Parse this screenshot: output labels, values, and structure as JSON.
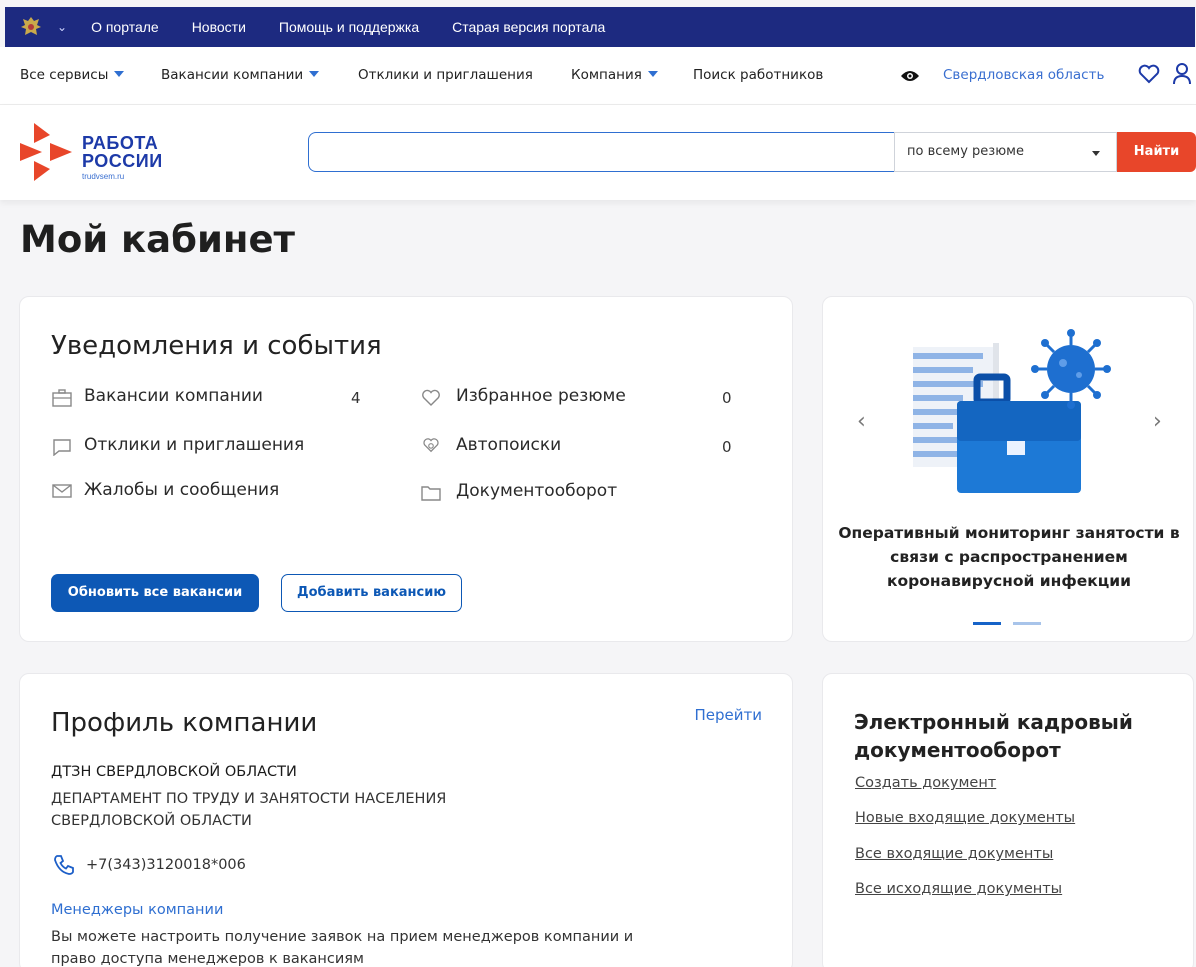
{
  "govbar": {
    "links": [
      "О портале",
      "Новости",
      "Помощь и поддержка",
      "Старая версия портала"
    ]
  },
  "nav": {
    "all_services": "Все сервисы",
    "company_vacancies": "Вакансии компании",
    "responses": "Отклики и приглашения",
    "company": "Компания",
    "search_workers": "Поиск работников",
    "region": "Свердловская область"
  },
  "header": {
    "logo_line1": "РАБОТА",
    "logo_line2": "РОССИИ",
    "logo_sub": "trudvsem.ru",
    "search_value": "",
    "search_scope": "по всему резюме",
    "find_label": "Найти"
  },
  "page": {
    "title": "Мой кабинет"
  },
  "notifications": {
    "title": "Уведомления и события",
    "items": [
      {
        "label": "Вакансии компании",
        "count": "4",
        "icon": "briefcase-icon"
      },
      {
        "label": "Избранное резюме",
        "count": "0",
        "icon": "heart-icon"
      },
      {
        "label": "Отклики и приглашения",
        "count": "",
        "icon": "chat-icon"
      },
      {
        "label": "Автопоиски",
        "count": "0",
        "icon": "autosearch-icon"
      },
      {
        "label": "Жалобы и сообщения",
        "count": "",
        "icon": "mail-icon"
      },
      {
        "label": "Документооборот",
        "count": "",
        "icon": "folder-icon"
      }
    ],
    "update_all": "Обновить все вакансии",
    "add_vacancy": "Добавить вакансию"
  },
  "slider": {
    "caption": "Оперативный мониторинг занятости в связи с распространением коронавирусной инфекции",
    "slides": 2,
    "active": 1
  },
  "profile": {
    "title": "Профиль компании",
    "goto": "Перейти",
    "short_name": "ДТЗН СВЕРДЛОВСКОЙ ОБЛАСТИ",
    "full_name": "ДЕПАРТАМЕНТ ПО ТРУДУ И ЗАНЯТОСТИ НАСЕЛЕНИЯ СВЕРДЛОВСКОЙ ОБЛАСТИ",
    "phone": "+7(343)3120018*006",
    "managers_link": "Менеджеры компании",
    "managers_desc": "Вы можете настроить получение заявок на прием менеджеров компании и право доступа менеджеров к вакансиям"
  },
  "edo": {
    "title": "Электронный кадровый документооборот",
    "links": [
      "Создать документ",
      "Новые входящие документы",
      "Все входящие документы",
      "Все исходящие документы"
    ]
  },
  "colors": {
    "govbar": "#1d2a80",
    "accent": "#0d58b5",
    "find": "#e8462a",
    "link": "#2f6fd1"
  }
}
